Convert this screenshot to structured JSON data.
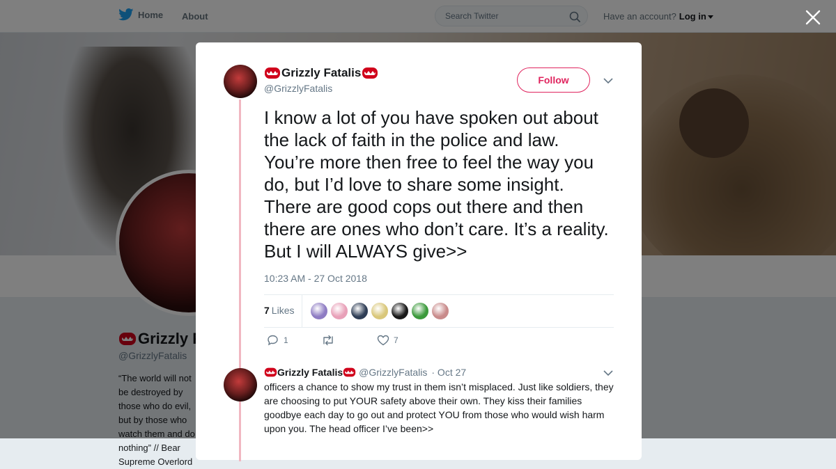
{
  "nav": {
    "home_label": "Home",
    "about_label": "About",
    "search_placeholder": "Search Twitter",
    "have_account": "Have an account?",
    "login_label": "Log in"
  },
  "profile": {
    "name": "Grizzly F",
    "handle": "@GrizzlyFatalis",
    "bio": "“The world will not be destroyed by those who do evil, but by those who watch them and do nothing” // Bear Supreme Overlord"
  },
  "tweet": {
    "author_name": "Grizzly Fatalis",
    "author_handle": "@GrizzlyFatalis",
    "follow_label": "Follow",
    "text": "I know a lot of you have spoken out about the lack of faith in the police and law. You’re more then free to feel the way you do, but I’d love to share some insight. There are good cops out there and then there are ones who don’t care. It’s a reality. But I will ALWAYS give>>",
    "timestamp": "10:23 AM - 27 Oct 2018",
    "likes_count": "7",
    "likes_label": "Likes",
    "reply_count": "1",
    "like_action_count": "7"
  },
  "reply": {
    "author_name": "Grizzly Fatalis",
    "author_handle": "@GrizzlyFatalis",
    "date": "· Oct 27",
    "text": "officers a chance to show my trust in them isn’t misplaced. Just like soldiers, they are choosing to put YOUR safety above their own. They kiss their families goodbye each day to go out and protect YOU from those who would wish harm upon you. The head officer I’ve been>>"
  },
  "likers": [
    {
      "name": "liker-1",
      "color": "#8e7cc3"
    },
    {
      "name": "liker-2",
      "color": "#e8a0b8"
    },
    {
      "name": "liker-3",
      "color": "#2f3e56"
    },
    {
      "name": "liker-4",
      "color": "#d9c77a"
    },
    {
      "name": "liker-5",
      "color": "#1a1a1a"
    },
    {
      "name": "liker-6",
      "color": "#3c9a3c"
    },
    {
      "name": "liker-7",
      "color": "#c98b8b"
    }
  ],
  "colors": {
    "brand": "#1da1f2",
    "accent": "#e0245e",
    "thread_line": "#f1b7c1",
    "text_secondary": "#657786"
  },
  "icons": [
    "twitter-bird-icon",
    "search-icon",
    "close-icon",
    "chevron-down-icon",
    "reply-icon",
    "retweet-icon",
    "heart-icon",
    "bear-mouth-emoji-icon"
  ]
}
